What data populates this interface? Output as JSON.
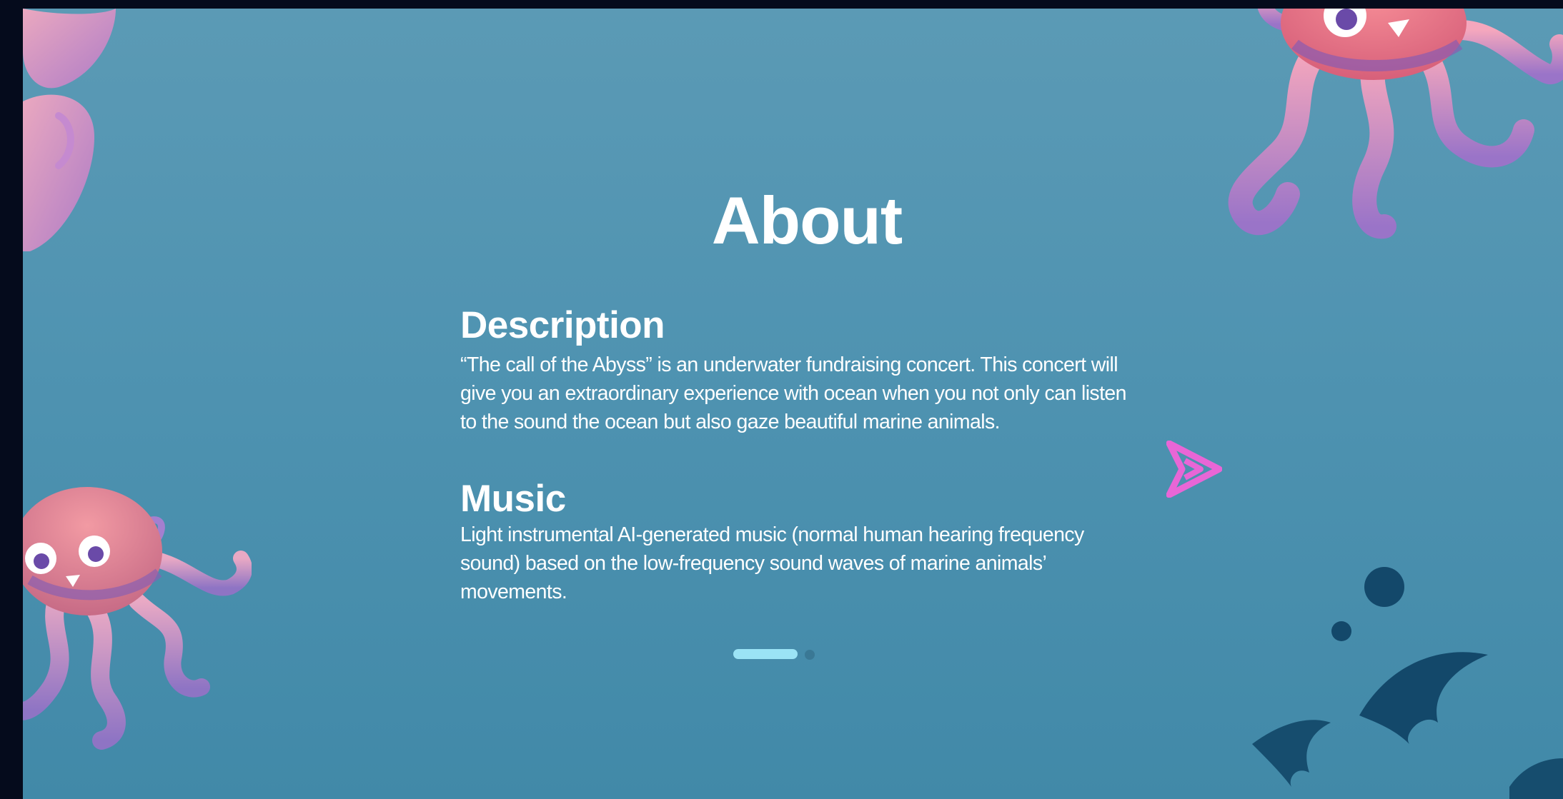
{
  "page": {
    "title": "About"
  },
  "sections": [
    {
      "heading": "Description",
      "text": "“The call of the Abyss” is an underwater fundraising concert. This concert will give you an extraordinary experience with ocean when you not only can listen to the sound the ocean but also gaze beautiful marine animals."
    },
    {
      "heading": "Music",
      "text": "Light instrumental AI-generated music (normal human hearing frequency sound) based on the low-frequency sound waves of marine animals’ movements."
    }
  ],
  "carousel": {
    "current_page": 1,
    "total_pages": 2
  },
  "colors": {
    "background_top": "#5b9ab5",
    "background_bottom": "#4189a8",
    "active_dot": "#9be3f5",
    "inactive_dot": "#3a7895",
    "arrow": "#e866d6",
    "jellyfish_pink": "#f28b9b",
    "jellyfish_purple": "#9d79c9",
    "fish": "#13486a"
  },
  "icons": {
    "next": "arrow-right-icon"
  }
}
